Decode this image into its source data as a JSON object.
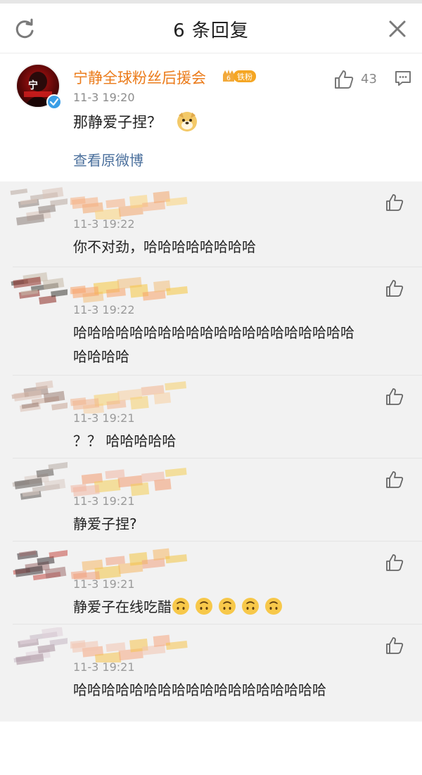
{
  "header": {
    "title": "6 条回复",
    "refresh_icon": "refresh-icon",
    "close_icon": "close-icon"
  },
  "main_post": {
    "author": "宁静全球粉丝后援会",
    "fan_badge_label": "铁粉",
    "fan_badge_level": "6",
    "time": "11-3 19:20",
    "text": "那静爱子捏？",
    "emoji": "doge-emoji",
    "view_original": "查看原微博",
    "like_count": "43",
    "avatar_text": "宁"
  },
  "replies": [
    {
      "time": "11-3 19:22",
      "lines": [
        "你不对劲，哈哈哈哈哈哈哈哈"
      ]
    },
    {
      "time": "11-3 19:22",
      "lines": [
        "哈哈哈哈哈哈哈哈哈哈哈哈哈哈哈哈哈哈哈哈",
        "哈哈哈哈"
      ]
    },
    {
      "time": "11-3 19:21",
      "lines": [
        "？？ 哈哈哈哈哈"
      ]
    },
    {
      "time": "11-3 19:21",
      "lines": [
        "静爱子捏?"
      ]
    },
    {
      "time": "11-3 19:21",
      "lines": [
        "静爱子在线吃醋"
      ],
      "emoji_count": 5,
      "emoji": "upside-down-face-emoji"
    },
    {
      "time": "11-3 19:21",
      "lines": [
        "哈哈哈哈哈哈哈哈哈哈哈哈哈哈哈哈哈哈"
      ]
    }
  ],
  "colors": {
    "author": "#eb7b1a",
    "link": "#4a6f9c",
    "reply_bg": "#f2f2f2",
    "verified": "#3a9ee6"
  }
}
